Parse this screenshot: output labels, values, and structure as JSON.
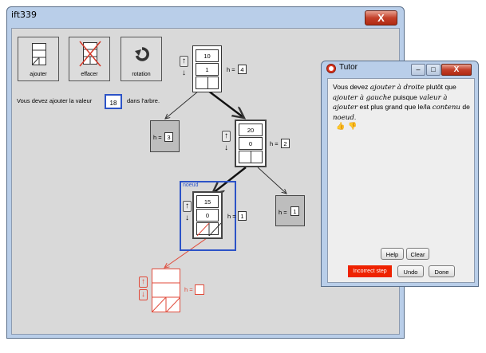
{
  "main_window": {
    "title": "ift339",
    "close_glyph": "X",
    "toolbar": {
      "add_label": "ajouter",
      "delete_label": "effacer",
      "rotate_label": "rotation"
    },
    "message": {
      "before": "Vous devez ajouter la valeur",
      "value": "18",
      "after": "dans l'arbre."
    },
    "tree": {
      "root": {
        "value": "10",
        "balance": "1",
        "height_label": "h =",
        "height": "4"
      },
      "left_leaf": {
        "height_label": "h =",
        "height": "3"
      },
      "right": {
        "value": "20",
        "balance": "0",
        "height_label": "h =",
        "height": "2"
      },
      "right_right_leaf": {
        "height_label": "h =",
        "height": "1"
      },
      "focus": {
        "tag": "noeud",
        "value": "15",
        "balance": "0",
        "height_label": "h =",
        "height": "1"
      },
      "new_node": {
        "height_label": "h =",
        "height": ""
      }
    }
  },
  "tutor": {
    "title": "Tutor",
    "message": {
      "p1": "Vous devez ",
      "em1": "ajouter à droite",
      "p2": " plutôt que ",
      "em2": "ajouter à gauche",
      "p3": " puisque ",
      "em3": "valeur à ajouter",
      "p4": " est plus grand que le/la ",
      "em4": "contenu",
      "p5": " de ",
      "em5": "noeud",
      "p6": "."
    },
    "help_label": "Help",
    "clear_label": "Clear",
    "status_label": "Incorrect step",
    "undo_label": "Undo",
    "done_label": "Done"
  },
  "colors": {
    "window_frame": "#b9cee9",
    "content_bg": "#d9d9d9",
    "focus_border": "#2c53c7",
    "new_node_red": "#e04a3a",
    "status_red": "#ee2200"
  }
}
